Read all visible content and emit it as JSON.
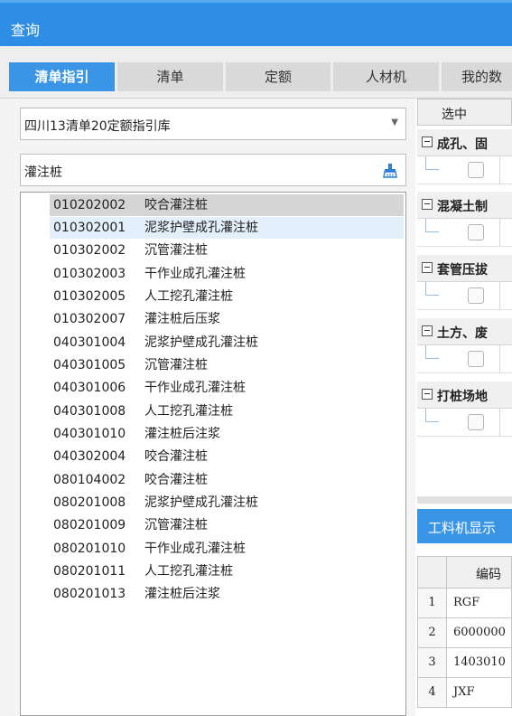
{
  "window": {
    "title": "查询"
  },
  "tabs": [
    "清单指引",
    "清单",
    "定额",
    "人材机",
    "我的数"
  ],
  "library": {
    "selected": "四川13清单20定额指引库"
  },
  "search": {
    "value": "灌注桩"
  },
  "list": [
    {
      "code": "010202002",
      "name": "咬合灌注桩"
    },
    {
      "code": "010302001",
      "name": "泥浆护壁成孔灌注桩"
    },
    {
      "code": "010302002",
      "name": "沉管灌注桩"
    },
    {
      "code": "010302003",
      "name": "干作业成孔灌注桩"
    },
    {
      "code": "010302005",
      "name": "人工挖孔灌注桩"
    },
    {
      "code": "010302007",
      "name": "灌注桩后压浆"
    },
    {
      "code": "040301004",
      "name": "泥浆护壁成孔灌注桩"
    },
    {
      "code": "040301005",
      "name": "沉管灌注桩"
    },
    {
      "code": "040301006",
      "name": "干作业成孔灌注桩"
    },
    {
      "code": "040301008",
      "name": "人工挖孔灌注桩"
    },
    {
      "code": "040301010",
      "name": "灌注桩后注浆"
    },
    {
      "code": "040302004",
      "name": "咬合灌注桩"
    },
    {
      "code": "080104002",
      "name": "咬合灌注桩"
    },
    {
      "code": "080201008",
      "name": "泥浆护壁成孔灌注桩"
    },
    {
      "code": "080201009",
      "name": "沉管灌注桩"
    },
    {
      "code": "080201010",
      "name": "干作业成孔灌注桩"
    },
    {
      "code": "080201011",
      "name": "人工挖孔灌注桩"
    },
    {
      "code": "080201013",
      "name": "灌注桩后注浆"
    }
  ],
  "right": {
    "header": "选中",
    "groups": [
      "成孔、固",
      "混凝土制",
      "套管压拔",
      "土方、废",
      "打桩场地"
    ],
    "panel_title": "工料机显示",
    "table_header": "编码",
    "rows": [
      {
        "num": "1",
        "code": "RGF"
      },
      {
        "num": "2",
        "code": "6000000"
      },
      {
        "num": "3",
        "code": "1403010"
      },
      {
        "num": "4",
        "code": "JXF"
      }
    ]
  }
}
